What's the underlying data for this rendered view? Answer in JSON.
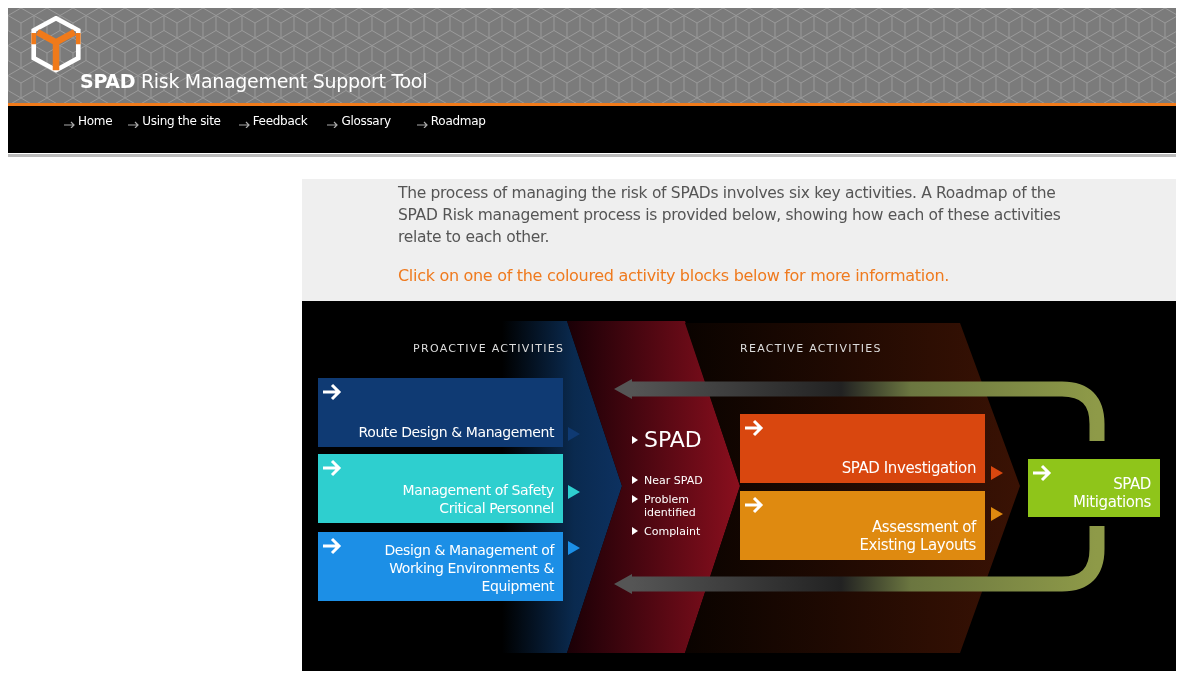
{
  "header": {
    "title": "**SPAD** Risk Management Support Tool"
  },
  "nav": [
    {
      "label": "Home"
    },
    {
      "label": "Using the site"
    },
    {
      "label": "Feedback"
    },
    {
      "label": "Glossary"
    },
    {
      "label": "Roadmap"
    }
  ],
  "intro": {
    "text": "The process of managing the risk of SPADs involves six key activities. A Roadmap of the SPAD Risk management process is provided below, showing how each of these activities relate to each other.",
    "instruction": "Click on one of the coloured activity blocks below for more information."
  },
  "roadmap": {
    "proactive_label": "PROACTIVE ACTIVITIES",
    "reactive_label": "REACTIVE ACTIVITIES",
    "proactive": [
      {
        "label": "Route Design & Management",
        "color": "#0f3a73"
      },
      {
        "label": "Management of Safety Critical Personnel",
        "color": "#2ecfcf"
      },
      {
        "label": "Design & Management of Working Environments & Equipment",
        "color": "#1c8fe6"
      }
    ],
    "spad": {
      "title": "SPAD",
      "items": [
        "Near SPAD",
        "Problem identified",
        "Complaint"
      ]
    },
    "reactive": [
      {
        "label": "SPAD Investigation",
        "color": "#d9470f"
      },
      {
        "label": "Assessment of Existing Layouts",
        "color": "#df8a10"
      }
    ],
    "mitigations": {
      "label": "SPAD Mitigations",
      "color": "#8fc51a"
    }
  }
}
